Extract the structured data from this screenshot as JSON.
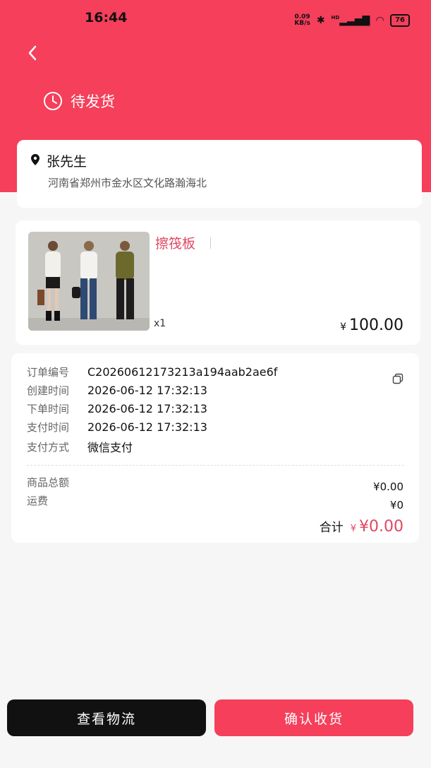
{
  "status_bar": {
    "time": "16:44",
    "net_speed_value": "0.09",
    "net_speed_unit": "KB/s",
    "signal_label": "HD",
    "battery": "76"
  },
  "header": {
    "status_label": "待发货"
  },
  "address": {
    "name": "张先生",
    "detail": "河南省郑州市金水区文化路瀚海北"
  },
  "product": {
    "name": "擦筏板",
    "quantity": "x1",
    "currency": "¥",
    "price": "100.00"
  },
  "order_info": {
    "rows": [
      {
        "label": "订单编号",
        "value": "C20260612173213a194aab2ae6f"
      },
      {
        "label": "创建时间",
        "value": "2026-06-12 17:32:13"
      },
      {
        "label": "下单时间",
        "value": "2026-06-12 17:32:13"
      },
      {
        "label": "支付时间",
        "value": "2026-06-12 17:32:13"
      },
      {
        "label": "支付方式",
        "value": "微信支付"
      }
    ],
    "goods_total_label": "商品总额",
    "goods_total_value": "¥0.00",
    "shipping_label": "运费",
    "shipping_value": "¥0",
    "total_label": "合计",
    "total_currency": "¥",
    "total_value": "¥0.00"
  },
  "actions": {
    "view_logistics": "查看物流",
    "confirm_receipt": "确认收货"
  },
  "colors": {
    "brand": "#f53f5b",
    "price_accent": "#e04862",
    "dark_button": "#111111"
  }
}
